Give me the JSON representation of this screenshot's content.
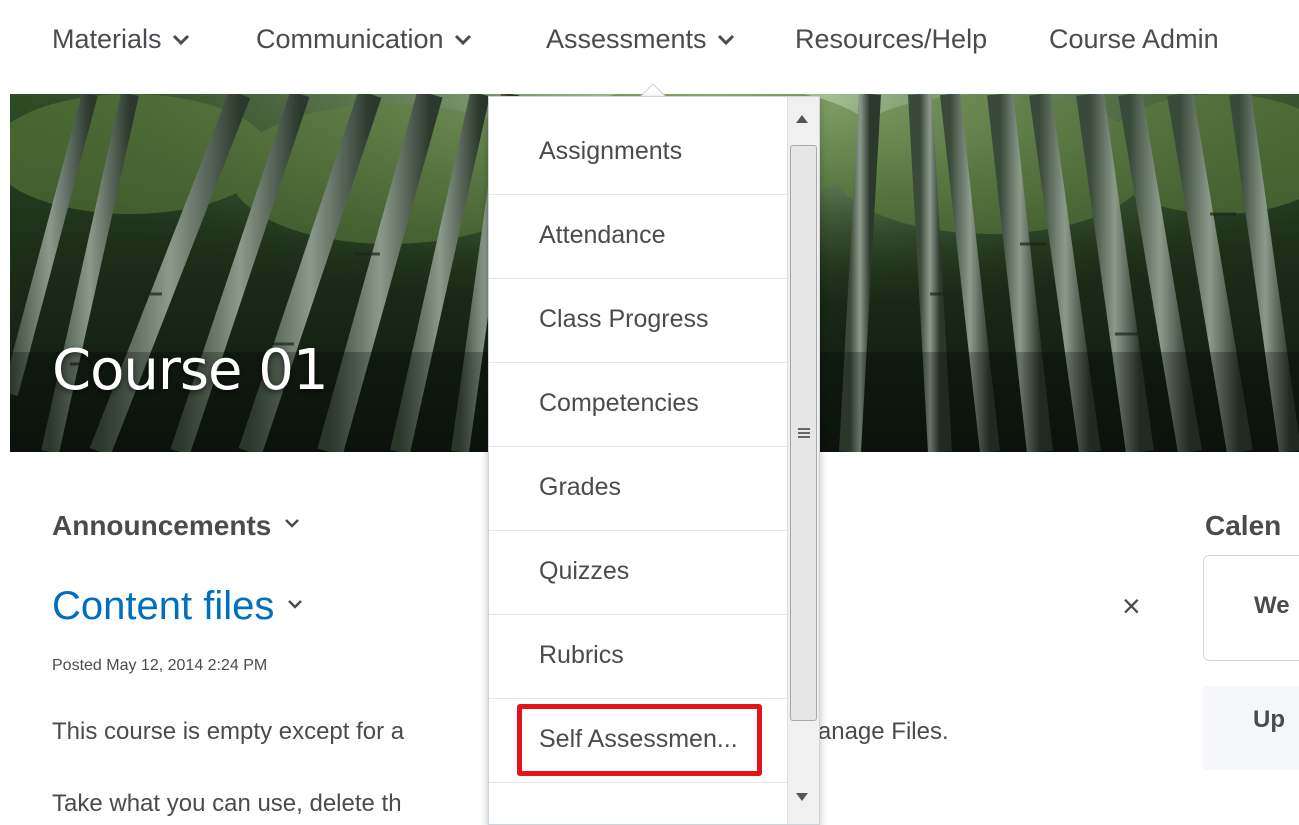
{
  "nav": {
    "items": [
      {
        "label": "Materials",
        "has_chevron": true
      },
      {
        "label": "Communication",
        "has_chevron": true
      },
      {
        "label": "Assessments",
        "has_chevron": true
      },
      {
        "label": "Resources/Help",
        "has_chevron": false
      },
      {
        "label": "Course Admin",
        "has_chevron": false
      }
    ]
  },
  "banner": {
    "course_title": "Course 01"
  },
  "dropdown": {
    "items": [
      "Assignments",
      "Attendance",
      "Class Progress",
      "Competencies",
      "Grades",
      "Quizzes",
      "Rubrics",
      "Self Assessmen..."
    ],
    "highlighted_item": "Self Assessmen...",
    "highlight_color": "#e0141a"
  },
  "announcements": {
    "heading": "Announcements",
    "item_title": "Content files",
    "posted": "Posted May 12, 2014 2:24 PM",
    "para1_left": "This course is empty except for a",
    "para1_right": "ntained in Manage Files.",
    "para2_left": "Take what you can use, delete th",
    "dismiss_icon": "×"
  },
  "calendar": {
    "heading": "Calen",
    "box_label": "We",
    "upcoming_label": "Up"
  },
  "colors": {
    "link": "#006fbf",
    "text": "#494c4e"
  }
}
